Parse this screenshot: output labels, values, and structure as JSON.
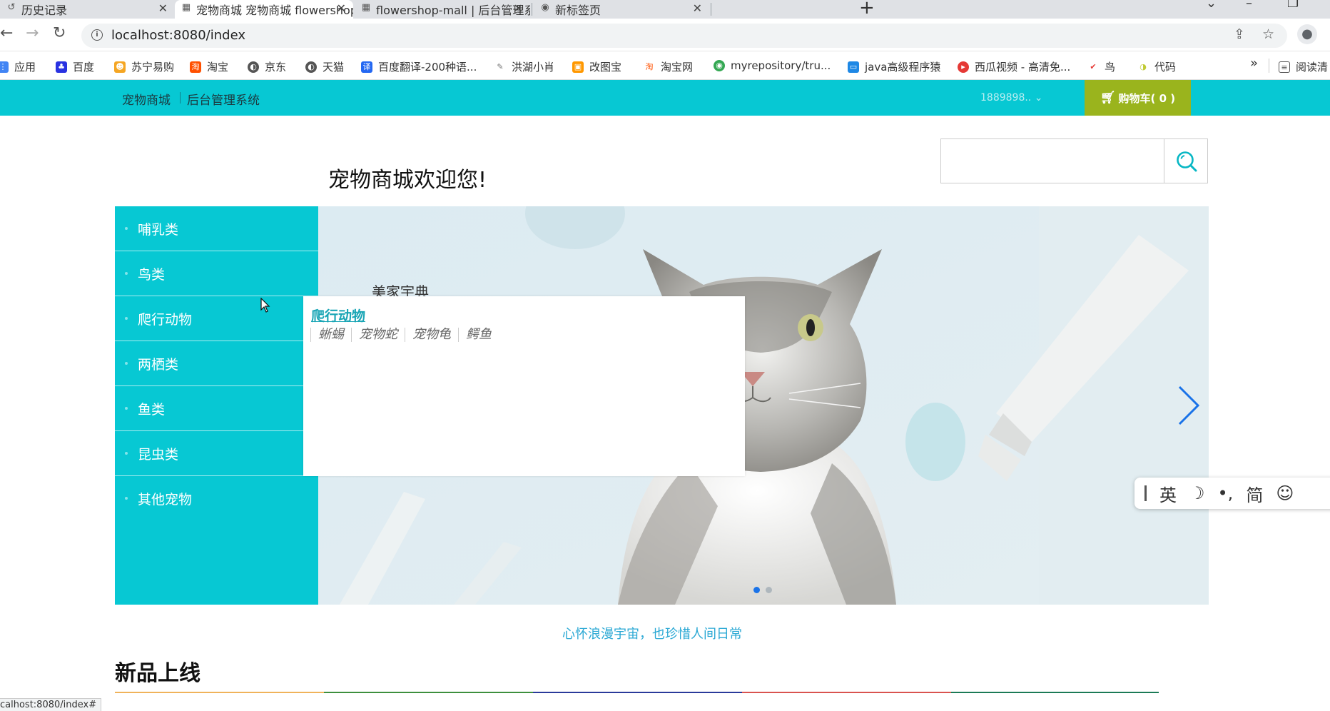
{
  "browser": {
    "tabs": [
      {
        "title": "历史记录",
        "close": "✕"
      },
      {
        "title": "宠物商城 宠物商城 flowershop",
        "close": "✕"
      },
      {
        "title": "flowershop-mall | 后台管理系统",
        "close": "✕"
      },
      {
        "title": "新标签页",
        "close": "✕"
      }
    ],
    "new_tab": "+",
    "url": "localhost:8080/index",
    "bookmarks": [
      {
        "label": "应用",
        "icon": "apps-grid-icon",
        "color": "#4285f4"
      },
      {
        "label": "百度",
        "icon": "baidu-paw-icon",
        "color": "#2932e1"
      },
      {
        "label": "苏宁易购",
        "icon": "suning-icon",
        "color": "#f5a623"
      },
      {
        "label": "淘宝",
        "icon": "taobao-icon",
        "color": "#ff5000"
      },
      {
        "label": "京东",
        "icon": "globe-icon",
        "color": "#555555"
      },
      {
        "label": "天猫",
        "icon": "globe-icon",
        "color": "#555555"
      },
      {
        "label": "百度翻译-200种语...",
        "icon": "translate-icon",
        "color": "#2468f2"
      },
      {
        "label": "洪湖小肖",
        "icon": "feather-icon",
        "color": "#777777"
      },
      {
        "label": "改图宝",
        "icon": "gaitubao-icon",
        "color": "#ff9800"
      },
      {
        "label": "淘宝网",
        "icon": "taobao-icon",
        "color": "#ff5000"
      },
      {
        "label": "myrepository/tru...",
        "icon": "chrome-icon",
        "color": "#34a853"
      },
      {
        "label": "java高级程序猿",
        "icon": "bilibili-icon",
        "color": "#1e88e5"
      },
      {
        "label": "西瓜视频 - 高清免...",
        "icon": "xigua-icon",
        "color": "#e53935"
      },
      {
        "label": "鸟",
        "icon": "bird-icon",
        "color": "#e53935"
      },
      {
        "label": "代码",
        "icon": "leaf-icon",
        "color": "#c0ca33"
      },
      {
        "label": "阅读清",
        "icon": "reading-list-icon",
        "color": "#555555"
      }
    ],
    "more_bookmarks": "»",
    "status_url": "calhost:8080/index#"
  },
  "site": {
    "nav_home": "宠物商城",
    "nav_admin": "后台管理系统",
    "user_phone": "1889898..",
    "cart_label": "购物车( 0 )",
    "welcome": "宠物商城欢迎您!",
    "search_placeholder": ""
  },
  "categories": [
    {
      "label": "哺乳类"
    },
    {
      "label": "鸟类"
    },
    {
      "label": "爬行动物"
    },
    {
      "label": "两栖类"
    },
    {
      "label": "鱼类"
    },
    {
      "label": "昆虫类"
    },
    {
      "label": "其他宠物"
    }
  ],
  "submenu": {
    "title": "爬行动物",
    "items": [
      "蜥蜴",
      "宠物蛇",
      "宠物龟",
      "鳄鱼"
    ]
  },
  "banner": {
    "caption": "美家宇典",
    "slides": 2,
    "active_slide": 1
  },
  "ime": {
    "items": [
      "英",
      "☽",
      "•,",
      "简",
      "☺"
    ]
  },
  "slogan": "心怀浪漫宇宙，也珍惜人间日常",
  "section_title": "新品上线",
  "colors": {
    "accent": "#07c8d3",
    "cart_bg": "#9ab41d",
    "link": "#19a5b5",
    "slogan": "#2aa8d4"
  }
}
